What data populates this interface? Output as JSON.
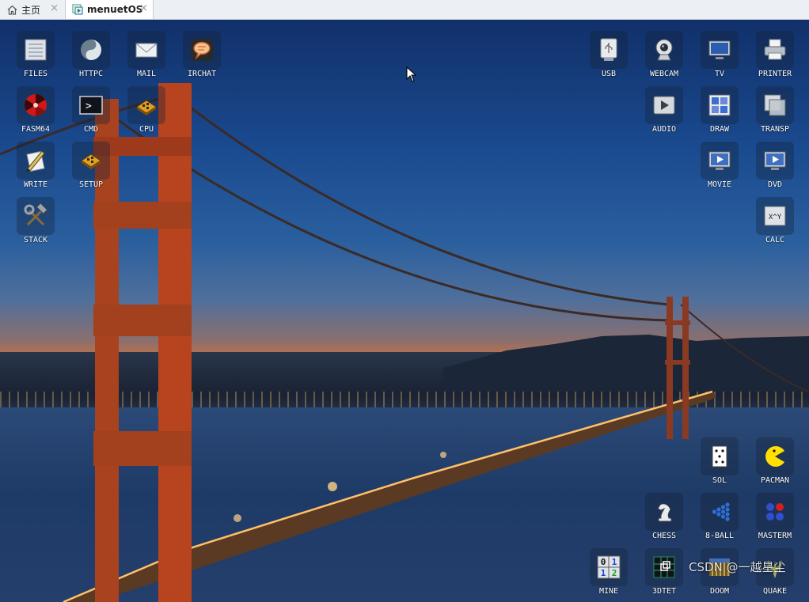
{
  "tabs": [
    {
      "label": "主页",
      "icon": "home-icon",
      "close": "×"
    },
    {
      "label": "menuetOS",
      "icon": "vm-icon",
      "close": "×"
    }
  ],
  "desktop": {
    "left_icons": [
      {
        "label": "FILES",
        "icon": "files-icon"
      },
      {
        "label": "HTTPC",
        "icon": "httpc-icon"
      },
      {
        "label": "MAIL",
        "icon": "mail-icon"
      },
      {
        "label": "IRCHAT",
        "icon": "irchat-icon"
      },
      {
        "label": "FASM64",
        "icon": "fasm64-icon"
      },
      {
        "label": "CMD",
        "icon": "cmd-icon"
      },
      {
        "label": "CPU",
        "icon": "cpu-icon"
      },
      {
        "label": "WRITE",
        "icon": "write-icon"
      },
      {
        "label": "SETUP",
        "icon": "setup-icon"
      },
      {
        "label": "STACK",
        "icon": "stack-icon"
      }
    ],
    "right_icons": [
      {
        "label": "USB",
        "icon": "usb-icon"
      },
      {
        "label": "WEBCAM",
        "icon": "webcam-icon"
      },
      {
        "label": "TV",
        "icon": "tv-icon"
      },
      {
        "label": "PRINTER",
        "icon": "printer-icon"
      },
      {
        "label": "AUDIO",
        "icon": "audio-icon"
      },
      {
        "label": "DRAW",
        "icon": "draw-icon"
      },
      {
        "label": "TRANSP",
        "icon": "transp-icon"
      },
      {
        "label": "MOVIE",
        "icon": "movie-icon"
      },
      {
        "label": "DVD",
        "icon": "dvd-icon"
      },
      {
        "label": "CALC",
        "icon": "calc-icon",
        "glyph": "X^Y"
      }
    ],
    "game_icons": [
      {
        "label": "SOL",
        "icon": "sol-icon"
      },
      {
        "label": "PACMAN",
        "icon": "pacman-icon"
      },
      {
        "label": "CHESS",
        "icon": "chess-icon"
      },
      {
        "label": "8-BALL",
        "icon": "8ball-icon"
      },
      {
        "label": "MASTERM",
        "icon": "masterm-icon"
      },
      {
        "label": "MINE",
        "icon": "mine-icon",
        "digits": [
          "0",
          "1",
          "1",
          "2"
        ]
      },
      {
        "label": "3DTET",
        "icon": "3dtet-icon"
      },
      {
        "label": "DOOM",
        "icon": "doom-icon"
      },
      {
        "label": "QUAKE",
        "icon": "quake-icon"
      }
    ],
    "cmd_glyph": ">"
  },
  "watermark": "CSDN @一越星尘",
  "colors": {
    "tabbar": "#eceff3",
    "sky_top": "#11306a",
    "sunset": "#c07048",
    "bridge": "#b8431f"
  }
}
